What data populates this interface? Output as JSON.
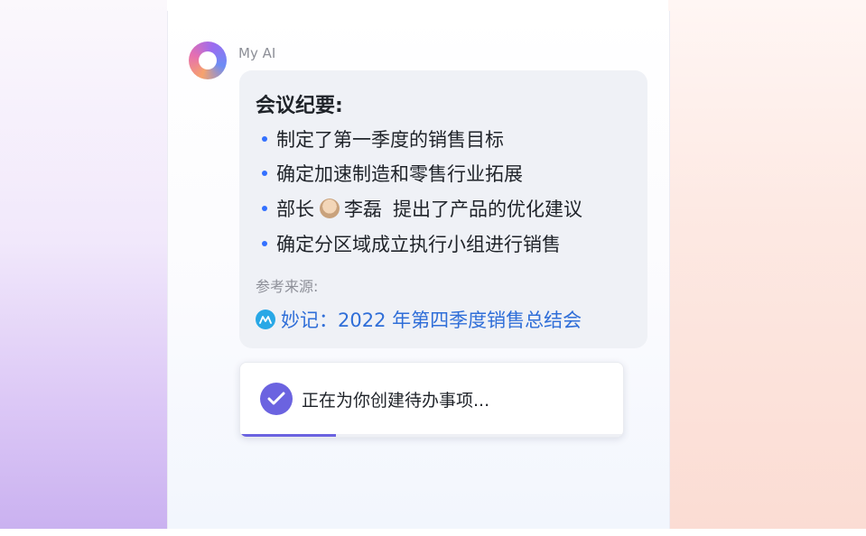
{
  "sender": "My AI",
  "summary": {
    "title": "会议纪要:",
    "items": [
      {
        "text": "制定了第一季度的销售目标"
      },
      {
        "text": "确定加速制造和零售行业拓展"
      },
      {
        "prefix": "部长",
        "mention": "李磊",
        "suffix": "提出了产品的优化建议"
      },
      {
        "text": "确定分区域成立执行小组进行销售"
      }
    ],
    "reference_label": "参考来源:",
    "reference_link": "妙记：2022 年第四季度销售总结会"
  },
  "task": {
    "status_text": "正在为你创建待办事项...",
    "progress": 0.25
  },
  "colors": {
    "accent": "#6b63e0",
    "link": "#2f6ed8",
    "bullet": "#3370ff"
  },
  "icons": {
    "assistant_avatar": "my-ai-logo-icon",
    "mention_avatar": "user-avatar-icon",
    "reference": "minutes-icon",
    "task": "check-badge-icon"
  }
}
